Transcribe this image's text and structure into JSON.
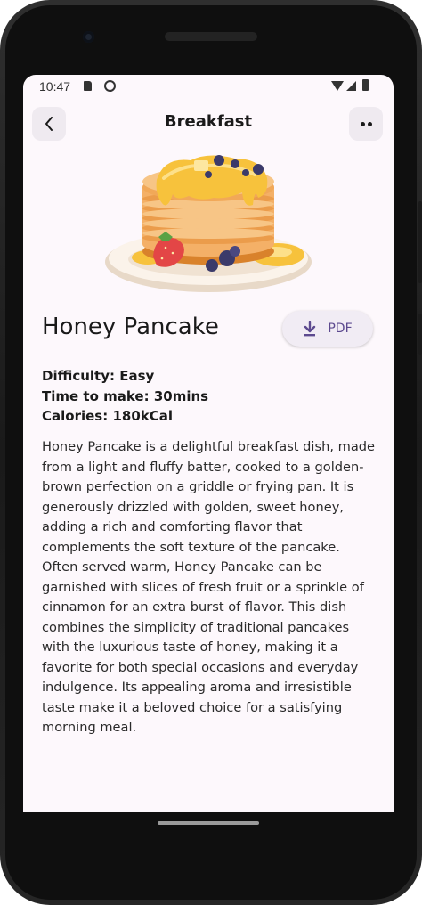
{
  "status_bar": {
    "time": "10:47"
  },
  "header": {
    "title": "Breakfast"
  },
  "recipe": {
    "name": "Honey Pancake",
    "pdf_label": "PDF",
    "difficulty": "Difficulty: Easy",
    "time_to_make": "Time to make: 30mins",
    "calories": "Calories: 180kCal",
    "description": "Honey Pancake is a delightful breakfast dish, made from a light and fluffy batter, cooked to a golden-brown perfection on a griddle or frying pan. It is generously drizzled with golden, sweet honey, adding a rich and comforting flavor that complements the soft texture of the pancake. Often served warm, Honey Pancake can be garnished with slices of fresh fruit or a sprinkle of cinnamon for an extra burst of flavor. This dish combines the simplicity of traditional pancakes with the luxurious taste of honey, making it a favorite for both special occasions and everyday indulgence. Its appealing aroma and irresistible taste make it a beloved choice for a satisfying morning meal."
  },
  "icons": {
    "back": "chevron-left-icon",
    "more": "more-horizontal-icon",
    "download": "download-icon",
    "illustration": "pancake-stack-illustration"
  },
  "colors": {
    "screen_background": "#fdf8fc",
    "pdf_button_background": "#f1ecf4",
    "pdf_accent": "#5d4a8f",
    "icon_button_background": "#efeaf0"
  }
}
